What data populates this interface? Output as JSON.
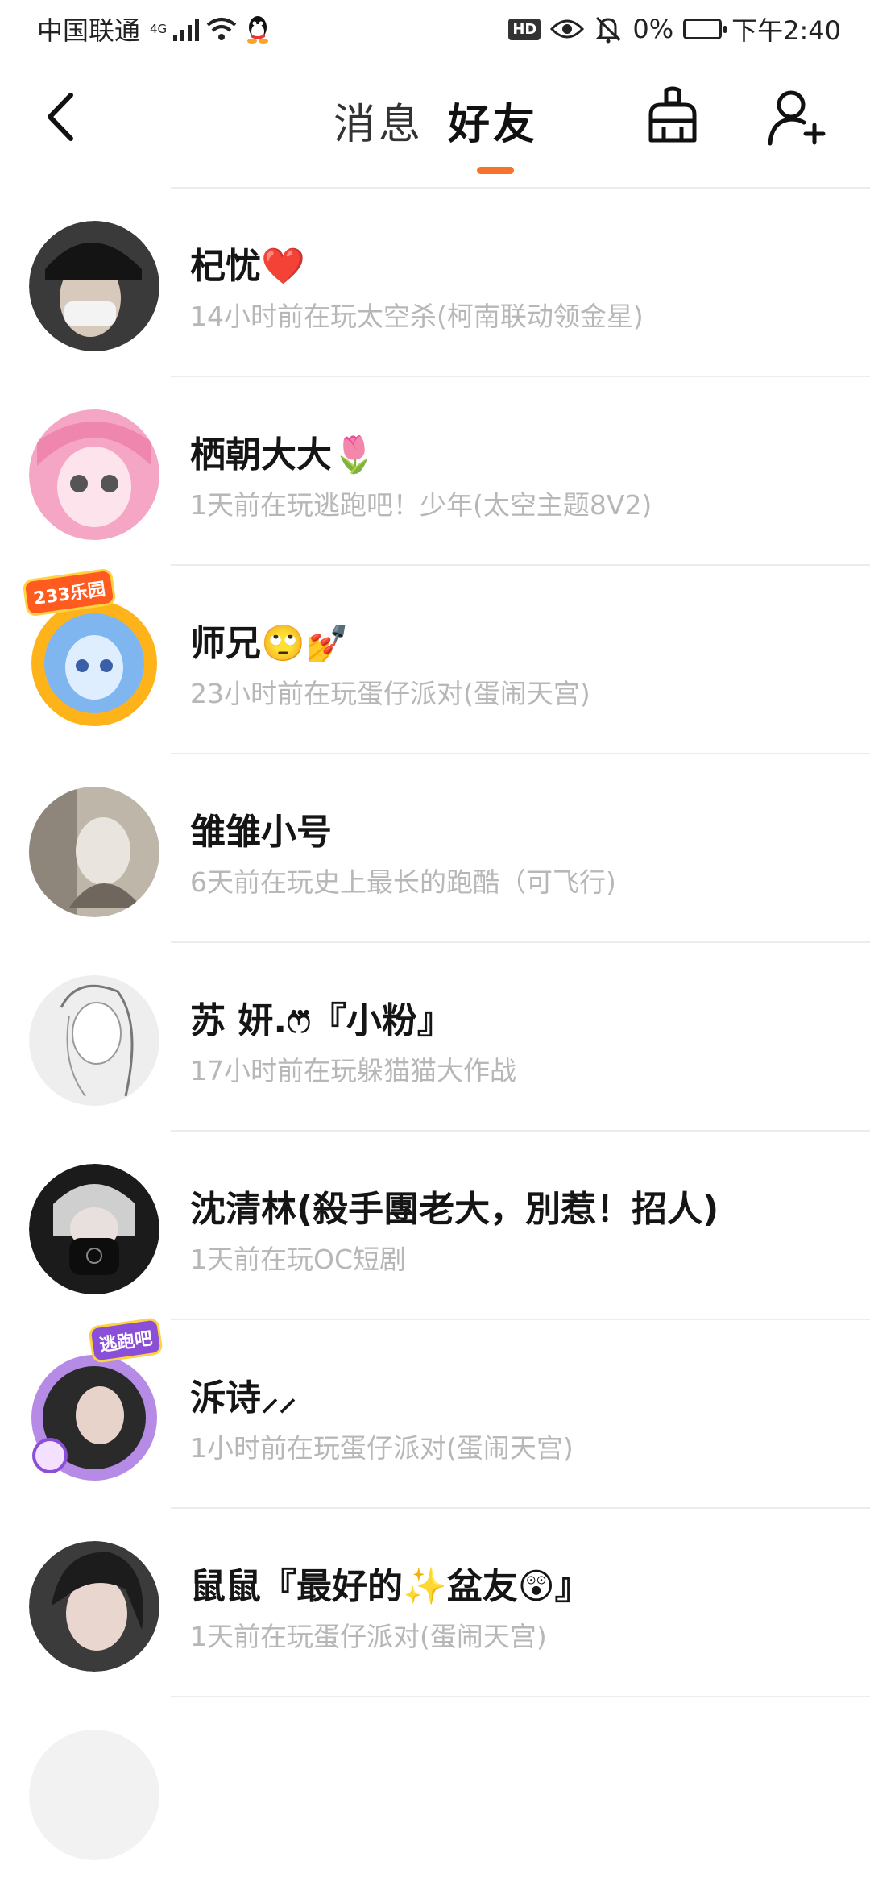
{
  "status_bar": {
    "carrier": "中国联通",
    "network": "4G",
    "battery_percent": "0%",
    "time": "下午2:40",
    "icons": [
      "signal-icon",
      "wifi-icon",
      "qq-icon",
      "hd-icon",
      "eye-icon",
      "mute-icon",
      "battery-icon"
    ]
  },
  "nav": {
    "tabs": [
      {
        "label": "消息",
        "active": false
      },
      {
        "label": "好友",
        "active": true
      }
    ],
    "accent": "#f4742b",
    "icons": [
      "back-icon",
      "broom-icon",
      "add-friend-icon"
    ]
  },
  "friends": [
    {
      "name": "杞忧❤️",
      "status": "14小时前在玩太空杀(柯南联动领金星)",
      "avatar": {
        "bg": "#3a3a3a",
        "accent": "#d8c9bd"
      }
    },
    {
      "name": "栖朝大大🌷",
      "status": "1天前在玩逃跑吧！少年(太空主题8V2)",
      "avatar": {
        "bg": "#f5a6c4",
        "accent": "#fde3ec"
      }
    },
    {
      "name": "师兄🙄💅",
      "status": "23小时前在玩蛋仔派对(蛋闹天宫)",
      "avatar": {
        "bg": "#7fb6f0",
        "accent": "#ffb31a"
      },
      "frame_badge": "233乐园"
    },
    {
      "name": "雏雏小号",
      "status": "6天前在玩史上最长的跑酷（可飞行)",
      "avatar": {
        "bg": "#bfb6aa",
        "accent": "#e9e4dd"
      }
    },
    {
      "name": "苏 妍.ෆ⃛『小粉』",
      "status": "17小时前在玩躲猫猫大作战",
      "avatar": {
        "bg": "#eeeeee",
        "accent": "#bbbbbb"
      }
    },
    {
      "name": "沈清林(殺手團老大，別惹！招人)",
      "status": "1天前在玩OC短剧",
      "avatar": {
        "bg": "#1b1b1b",
        "accent": "#888888"
      }
    },
    {
      "name": "泝诗⸝⸝",
      "status": "1小时前在玩蛋仔派对(蛋闹天宫)",
      "avatar": {
        "bg": "#2a2a2a",
        "accent": "#b58be6"
      },
      "frame_badge": "逃跑吧"
    },
    {
      "name": "鼠鼠『最好的✨盆友😲』",
      "status": "1天前在玩蛋仔派对(蛋闹天宫)",
      "avatar": {
        "bg": "#3b3b3b",
        "accent": "#e8d6cf"
      }
    }
  ]
}
